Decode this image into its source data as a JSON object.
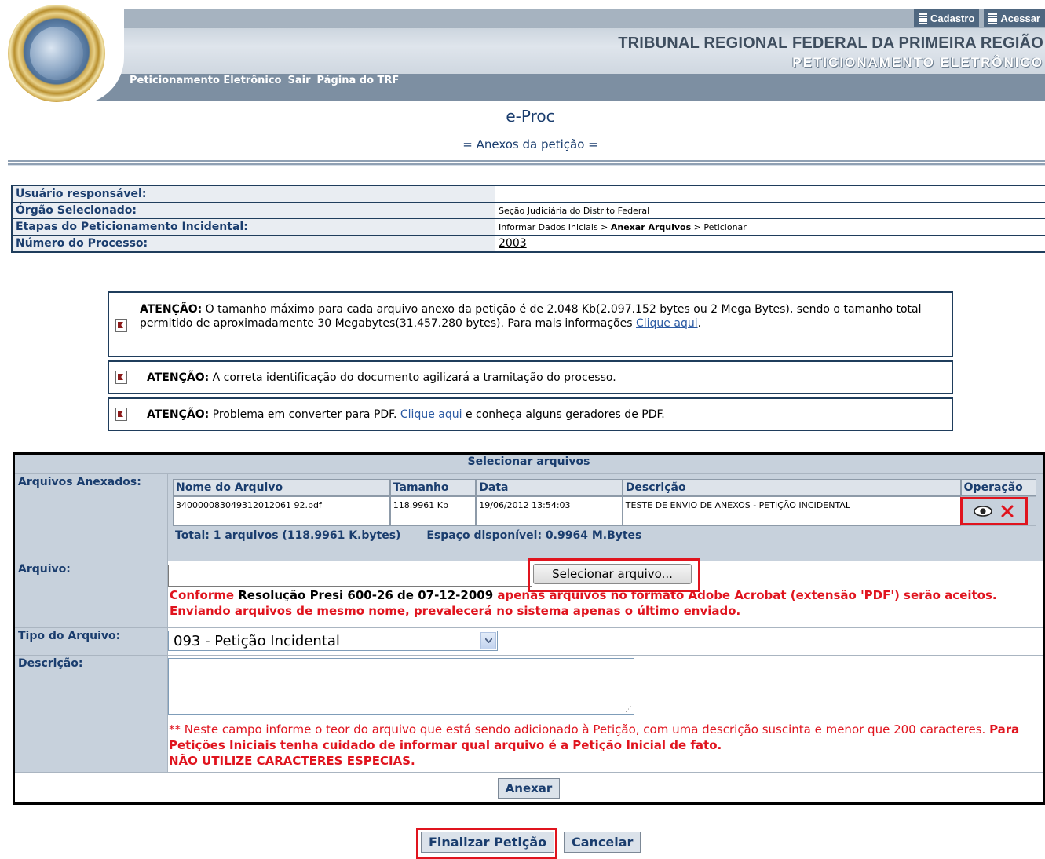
{
  "header": {
    "buttons": [
      "Cadastro",
      "Acessar"
    ],
    "court_name": "TRIBUNAL REGIONAL FEDERAL DA PRIMEIRA REGIÃO",
    "system_name": "PETICIONAMENTO ELETRÔNICO",
    "nav": [
      "Peticionamento Eletrônico",
      "Sair",
      "Página do TRF"
    ]
  },
  "page": {
    "app_title": "e-Proc",
    "subtitle": "= Anexos da petição ="
  },
  "info": {
    "rows": [
      {
        "label": "Usuário responsável:",
        "value": ""
      },
      {
        "label": "Órgão Selecionado:",
        "value": "Seção Judiciária do Distrito Federal"
      },
      {
        "label": "Etapas do Peticionamento Incidental:",
        "value_pre": "Informar Dados Iniciais > ",
        "value_bold": "Anexar Arquivos",
        "value_post": " > Peticionar"
      },
      {
        "label": "Número do Processo:",
        "value": "2003"
      }
    ]
  },
  "attention": {
    "prefix": "ATENÇÃO:",
    "box1_text": " O tamanho máximo para cada arquivo anexo da petição é de 2.048 Kb(2.097.152 bytes ou 2 Mega Bytes), sendo o tamanho total permitido de aproximadamente 30 Megabytes(31.457.280 bytes). Para mais informações ",
    "box1_link": "Clique aqui",
    "box1_end": ".",
    "box2_text": " A correta identificação do documento agilizará a tramitação do processo.",
    "box3_text": " Problema em converter para PDF. ",
    "box3_link": "Clique aqui",
    "box3_end": " e conheça alguns geradores de PDF."
  },
  "form": {
    "section_title": "Selecionar arquivos",
    "attached_label": "Arquivos Anexados:",
    "columns": [
      "Nome do Arquivo",
      "Tamanho",
      "Data",
      "Descrição",
      "Operação"
    ],
    "files": [
      {
        "name": "340000083049312012061 92.pdf",
        "size": "118.9961 Kb",
        "date": "19/06/2012 13:54:03",
        "description": "TESTE DE ENVIO DE ANEXOS - PETIÇÃO INCIDENTAL"
      }
    ],
    "total": "Total: 1 arquivos (118.9961 K.bytes)",
    "space": "Espaço disponível: 0.9964 M.Bytes",
    "file_label": "Arquivo:",
    "select_button": "Selecionar arquivo...",
    "rule_red1": "Conforme ",
    "rule_black": "Resolução Presi 600-26 de 07-12-2009",
    "rule_red2": " apenas arquivos no formato Adobe Acrobat (extensão 'PDF') serão aceitos. Enviando arquivos de mesmo nome, prevalecerá no sistema apenas o último enviado.",
    "type_label": "Tipo do Arquivo:",
    "type_value": "093 - Petição Incidental",
    "desc_label": "Descrição:",
    "desc_note_normal": "** Neste campo informe o teor do arquivo que está sendo adicionado à Petição, com uma descrição suscinta e menor que 200 caracteres. ",
    "desc_note_bold": "Para Petições Iniciais tenha cuidado de informar qual arquivo é a Petição Inicial de fato.",
    "desc_note_caps": "NÃO UTILIZE CARACTERES ESPECIAS.",
    "attach_button": "Anexar"
  },
  "footer": {
    "finish_button": "Finalizar Petição",
    "cancel_button": "Cancelar"
  }
}
